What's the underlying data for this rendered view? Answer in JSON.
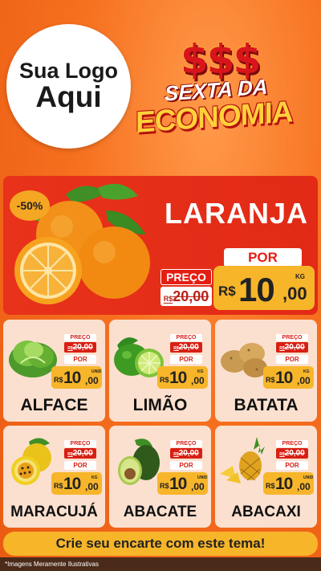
{
  "logo": {
    "line1": "Sua Logo",
    "line2": "Aqui"
  },
  "promo": {
    "symbols": "$$$",
    "line1": "SEXTA DA",
    "line2": "ECONOMIA"
  },
  "featured": {
    "discount": "-50%",
    "name": "LARANJA",
    "preco_label": "PREÇO",
    "old_currency": "R$",
    "old_price": "20,00",
    "por_label": "POR",
    "currency": "R$",
    "price_int": "10",
    "price_dec": ",00",
    "unit": "KG",
    "image_icon": "orange-icon"
  },
  "products": [
    {
      "name": "ALFACE",
      "preco_label": "PREÇO",
      "old_currency": "R$",
      "old_price": "20,00",
      "por_label": "POR",
      "currency": "R$",
      "price_int": "10",
      "price_dec": ",00",
      "unit": "UNID",
      "icon": "lettuce-icon"
    },
    {
      "name": "LIMÃO",
      "preco_label": "PREÇO",
      "old_currency": "R$",
      "old_price": "20,00",
      "por_label": "POR",
      "currency": "R$",
      "price_int": "10",
      "price_dec": ",00",
      "unit": "KG",
      "icon": "lime-icon"
    },
    {
      "name": "BATATA",
      "preco_label": "PREÇO",
      "old_currency": "R$",
      "old_price": "20,00",
      "por_label": "POR",
      "currency": "R$",
      "price_int": "10",
      "price_dec": ",00",
      "unit": "KG",
      "icon": "potato-icon"
    },
    {
      "name": "MARACUJÁ",
      "preco_label": "PREÇO",
      "old_currency": "R$",
      "old_price": "20,00",
      "por_label": "POR",
      "currency": "R$",
      "price_int": "10",
      "price_dec": ",00",
      "unit": "KG",
      "icon": "passion-fruit-icon"
    },
    {
      "name": "ABACATE",
      "preco_label": "PREÇO",
      "old_currency": "R$",
      "old_price": "20,00",
      "por_label": "POR",
      "currency": "R$",
      "price_int": "10",
      "price_dec": ",00",
      "unit": "UNID",
      "icon": "avocado-icon"
    },
    {
      "name": "ABACAXI",
      "preco_label": "PREÇO",
      "old_currency": "R$",
      "old_price": "20,00",
      "por_label": "POR",
      "currency": "R$",
      "price_int": "10",
      "price_dec": ",00",
      "unit": "UNID",
      "icon": "pineapple-icon"
    }
  ],
  "cta": "Crie seu encarte com este tema!",
  "footer_note": "*Imagens Meramente Ilustrativas",
  "colors": {
    "background": "#f26a1b",
    "accent_red": "#e41e14",
    "accent_yellow": "#f7b52a",
    "card_bg": "#fbe0cf"
  }
}
